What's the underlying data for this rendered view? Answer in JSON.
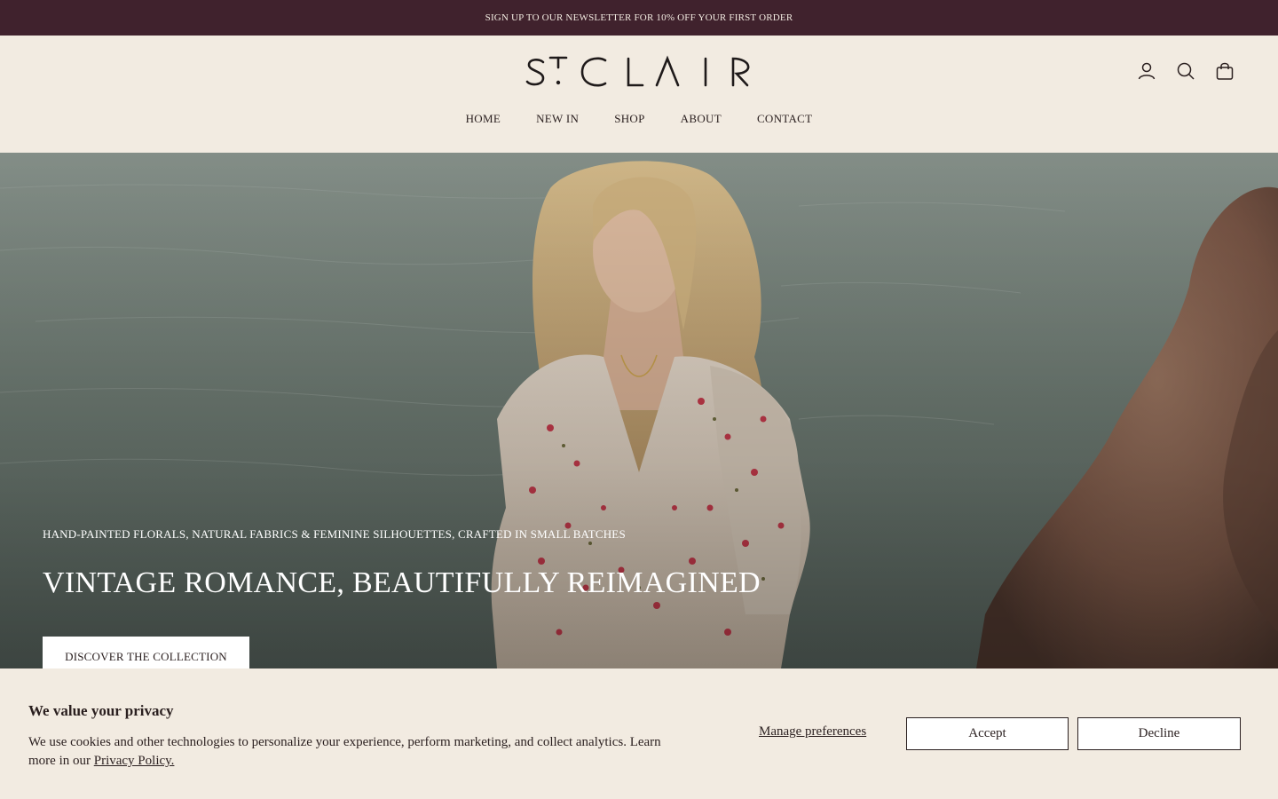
{
  "announcement": {
    "text": "SIGN UP TO OUR NEWSLETTER FOR 10% OFF YOUR FIRST ORDER"
  },
  "header": {
    "logo_text": "StCLAIR",
    "icons": [
      "account-icon",
      "search-icon",
      "bag-icon"
    ],
    "nav": [
      {
        "label": "HOME"
      },
      {
        "label": "NEW IN"
      },
      {
        "label": "SHOP"
      },
      {
        "label": "ABOUT"
      },
      {
        "label": "CONTACT"
      }
    ]
  },
  "hero": {
    "subtitle": "HAND-PAINTED FLORALS, NATURAL FABRICS & FEMININE SILHOUETTES, CRAFTED IN SMALL BATCHES",
    "title": "VINTAGE ROMANCE, BEAUTIFULLY REIMAGINED",
    "button_label": "DISCOVER THE COLLECTION"
  },
  "cookie_banner": {
    "title": "We value your privacy",
    "text": "We use cookies and other technologies to personalize your experience, perform marketing, and collect analytics. Learn more in our",
    "link_label": "Privacy Policy.",
    "manage_label": "Manage preferences",
    "accept_label": "Accept",
    "decline_label": "Decline"
  },
  "colors": {
    "announcement_bg": "#40222d",
    "page_bg": "#f2ebe1",
    "text": "#2a1f1f"
  }
}
